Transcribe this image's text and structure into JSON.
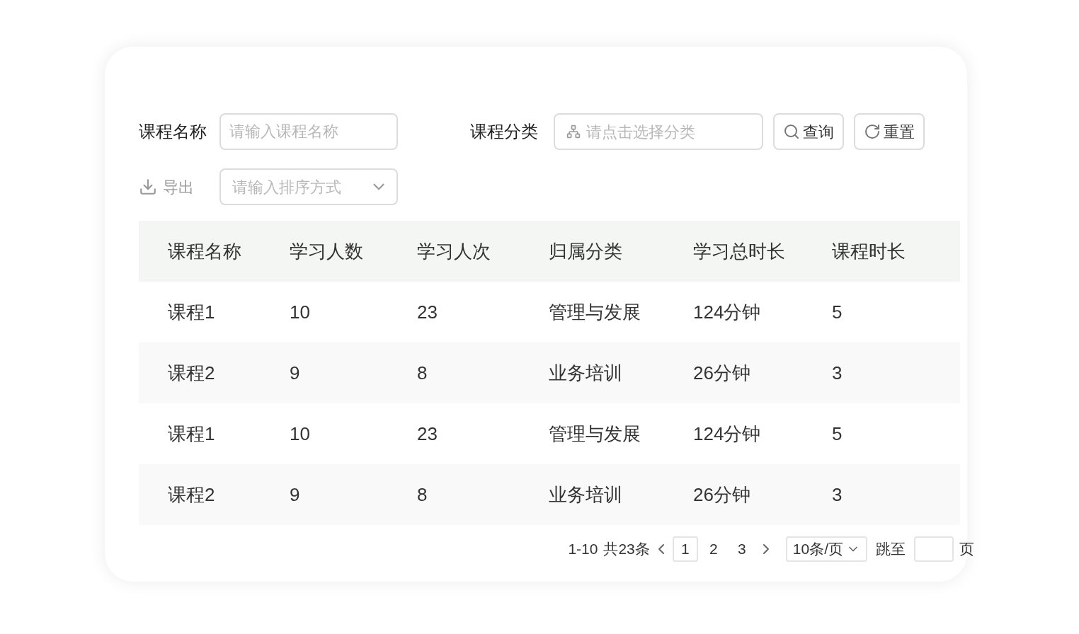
{
  "filters": {
    "course_name": {
      "label": "课程名称",
      "placeholder": "请输入课程名称"
    },
    "category": {
      "label": "课程分类",
      "placeholder": "请点击选择分类"
    },
    "buttons": [
      {
        "kind": "search",
        "label": "查询"
      },
      {
        "kind": "reset",
        "label": "重置"
      }
    ],
    "export": {
      "label": "导出",
      "disabled": true
    },
    "sort": {
      "placeholder": "请输入排序方式"
    }
  },
  "table": {
    "columns": [
      "课程名称",
      "学习人数",
      "学习人次",
      "归属分类",
      "学习总时长",
      "课程时长"
    ],
    "rows": [
      [
        "课程1",
        "10",
        "23",
        "管理与发展",
        "124分钟",
        "5"
      ],
      [
        "课程2",
        "9",
        "8",
        "业务培训",
        "26分钟",
        "3"
      ],
      [
        "课程1",
        "10",
        "23",
        "管理与发展",
        "124分钟",
        "5"
      ],
      [
        "课程2",
        "9",
        "8",
        "业务培训",
        "26分钟",
        "3"
      ]
    ]
  },
  "pagination": {
    "range": "1-10",
    "total": "共23条",
    "pages": [
      {
        "label": "1",
        "selected": true
      },
      {
        "label": "2",
        "selected": false
      },
      {
        "label": "3",
        "selected": false
      }
    ],
    "page_size": "10条/页",
    "jump_label": "跳至",
    "page_unit": "页"
  }
}
